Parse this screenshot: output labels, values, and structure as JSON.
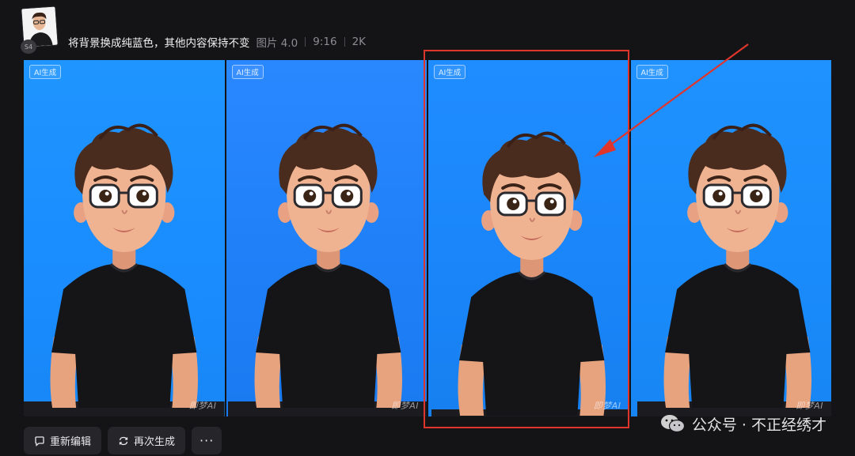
{
  "header": {
    "avatar_badge": "S4",
    "prompt": "将背景换成纯蓝色，其他内容保持不变",
    "model": "图片 4.0",
    "ratio": "9:16",
    "resolution": "2K"
  },
  "images": [
    {
      "badge": "AI生成",
      "watermark": "即梦AI"
    },
    {
      "badge": "AI生成",
      "watermark": "即梦AI"
    },
    {
      "badge": "AI生成",
      "watermark": "即梦AI"
    },
    {
      "badge": "AI生成",
      "watermark": "即梦AI"
    }
  ],
  "actions": {
    "edit_label": "重新编辑",
    "regen_label": "再次生成",
    "more_label": "···"
  },
  "footer": {
    "wechat_text": "公众号 · 不正经绣才"
  },
  "colors": {
    "background": "#141416",
    "tile_blue": "#1a8dff",
    "highlight": "#e0352b"
  },
  "icons": {
    "edit": "edit-icon",
    "regen": "refresh-icon",
    "more": "more-icon",
    "wechat": "wechat-icon"
  }
}
